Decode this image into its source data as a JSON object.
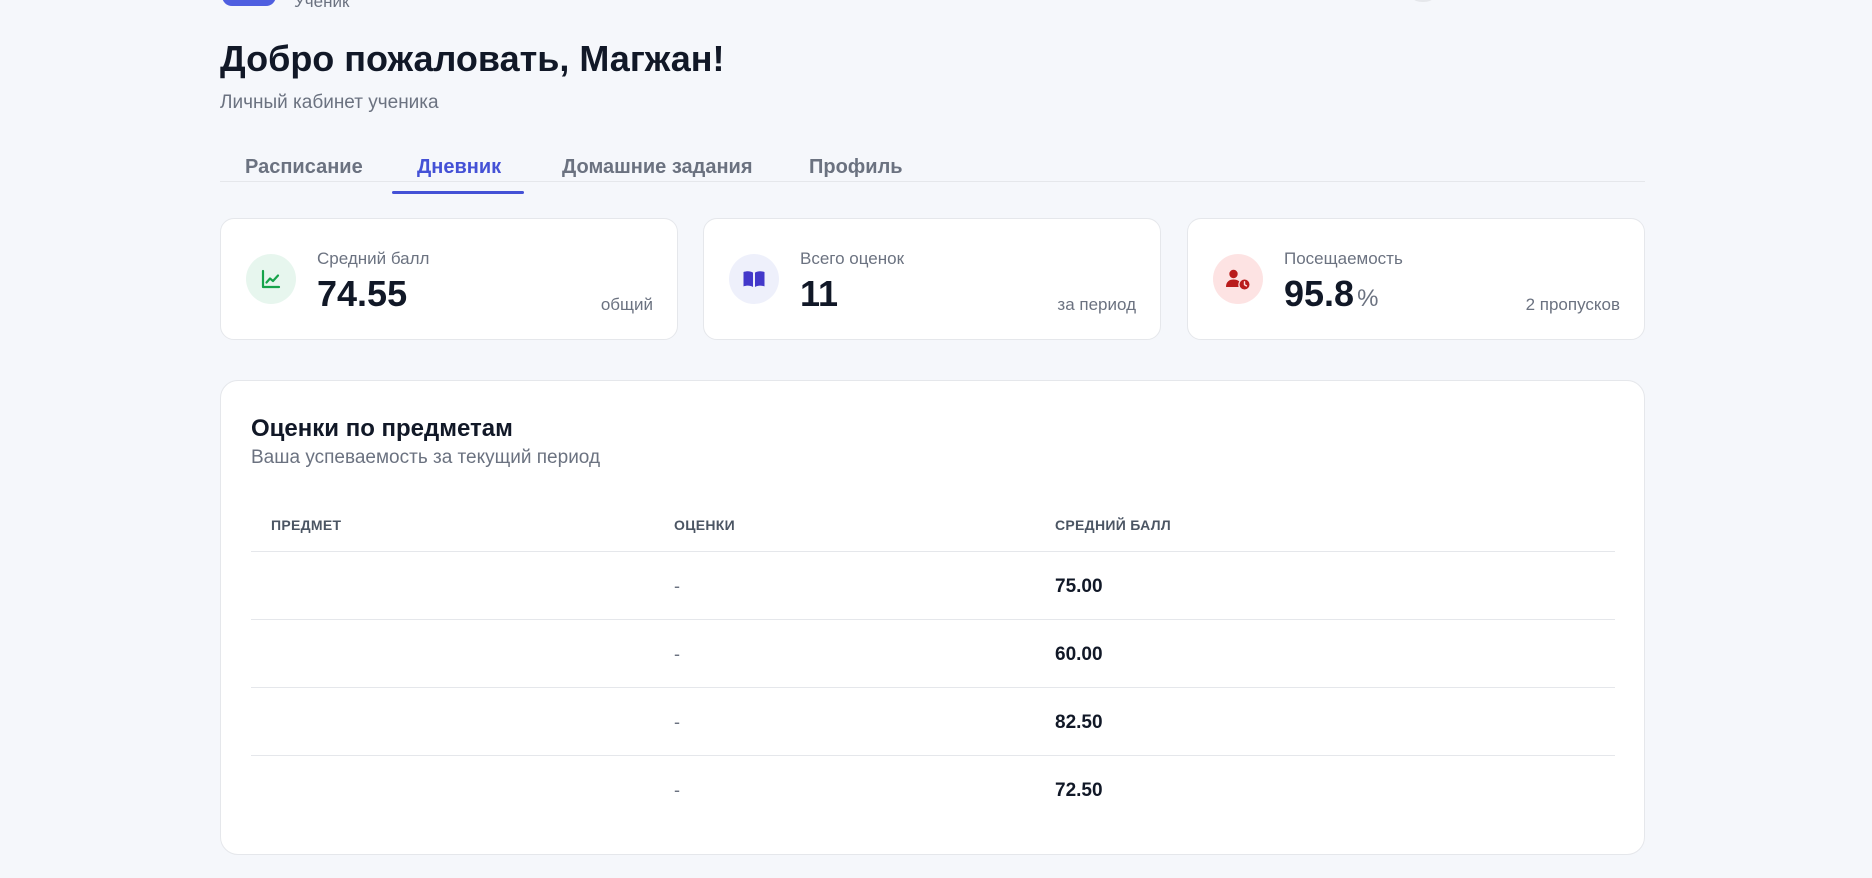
{
  "header": {
    "role_label": "Ученик"
  },
  "welcome": {
    "title": "Добро пожаловать, Магжан!",
    "subtitle": "Личный кабинет ученика"
  },
  "tabs": [
    {
      "label": "Расписание",
      "active": false
    },
    {
      "label": "Дневник",
      "active": true
    },
    {
      "label": "Домашние задания",
      "active": false
    },
    {
      "label": "Профиль",
      "active": false
    }
  ],
  "stats": {
    "average": {
      "label": "Средний балл",
      "value": "74.55",
      "note": "общий",
      "icon": "chart-line-icon",
      "icon_color": "#16a34a",
      "icon_bg": "#e7f6ee"
    },
    "total": {
      "label": "Всего оценок",
      "value": "11",
      "note": "за период",
      "icon": "book-icon",
      "icon_color": "#4338ca",
      "icon_bg": "#eef0fb"
    },
    "attendance": {
      "label": "Посещаемость",
      "value": "95.8",
      "unit": "%",
      "note": "2 пропусков",
      "icon": "user-clock-icon",
      "icon_color": "#b91c1c",
      "icon_bg": "#fde3e3"
    }
  },
  "grades": {
    "title": "Оценки по предметам",
    "subtitle": "Ваша успеваемость за текущий период",
    "columns": {
      "subject": "ПРЕДМЕТ",
      "grades": "ОЦЕНКИ",
      "average": "СРЕДНИЙ БАЛЛ"
    },
    "rows": [
      {
        "subject": "",
        "grades": "-",
        "average": "75.00"
      },
      {
        "subject": "",
        "grades": "-",
        "average": "60.00"
      },
      {
        "subject": "",
        "grades": "-",
        "average": "82.50"
      },
      {
        "subject": "",
        "grades": "-",
        "average": "72.50"
      }
    ]
  },
  "colors": {
    "accent": "#4451d6",
    "background": "#f5f7fb"
  }
}
